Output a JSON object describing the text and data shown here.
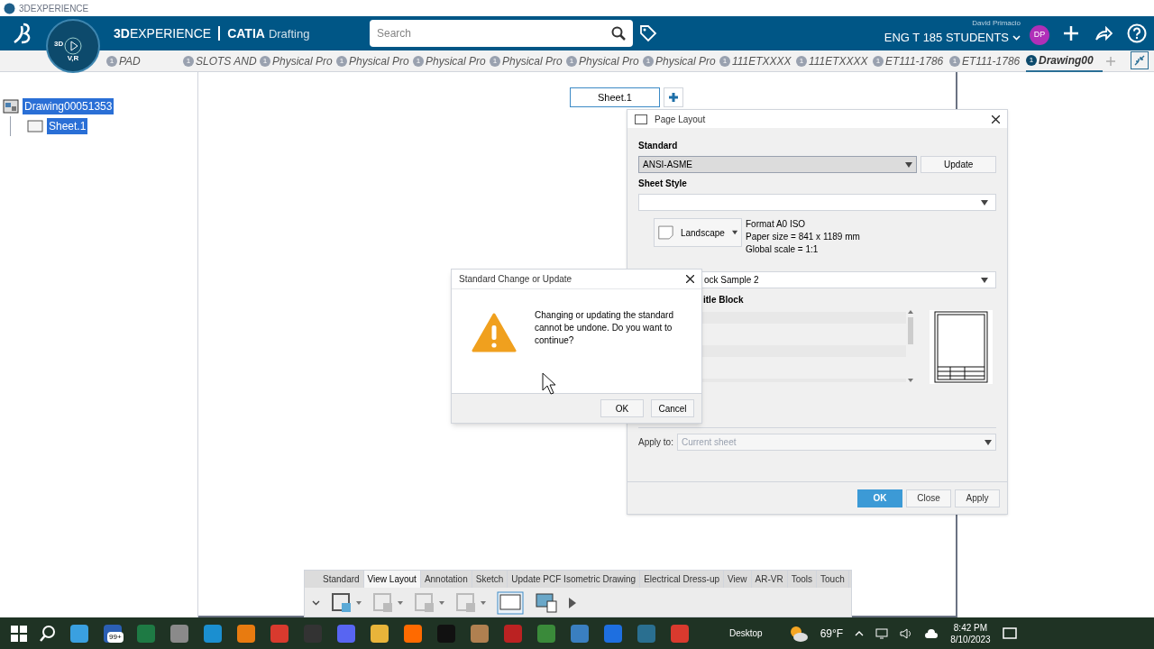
{
  "window": {
    "title": "3DEXPERIENCE"
  },
  "header": {
    "brand": "3DEXPERIENCE",
    "app": "CATIA",
    "module": "Drafting",
    "compass_labels": [
      "3D",
      "V,R"
    ],
    "search": {
      "placeholder": "Search"
    },
    "user": "David Primacio",
    "collab_space": "ENG T 185 STUDENTS",
    "avatar": "DP"
  },
  "tabs": [
    {
      "label": "PAD",
      "badge": "1",
      "selected": false
    },
    {
      "label": "SLOTS AND",
      "badge": "1",
      "selected": false
    },
    {
      "label": "Physical Pro",
      "badge": "1",
      "selected": false
    },
    {
      "label": "Physical Pro",
      "badge": "1",
      "selected": false
    },
    {
      "label": "Physical Pro",
      "badge": "1",
      "selected": false
    },
    {
      "label": "Physical Pro",
      "badge": "1",
      "selected": false
    },
    {
      "label": "Physical Pro",
      "badge": "1",
      "selected": false
    },
    {
      "label": "Physical Pro",
      "badge": "1",
      "selected": false
    },
    {
      "label": "111ETXXXX",
      "badge": "1",
      "selected": false
    },
    {
      "label": "111ETXXXX",
      "badge": "1",
      "selected": false
    },
    {
      "label": "ET111-1786",
      "badge": "1",
      "selected": false
    },
    {
      "label": "ET111-1786",
      "badge": "1",
      "selected": false
    },
    {
      "label": "Drawing00",
      "badge": "1",
      "selected": true
    }
  ],
  "tree": {
    "label": "Drawing00051353",
    "selected": true,
    "children": [
      {
        "label": "Sheet.1",
        "selected": true
      }
    ]
  },
  "sheet_tab": {
    "label": "Sheet.1"
  },
  "page_layout": {
    "title": "Page Layout",
    "standard_label": "Standard",
    "standard_value": "ANSI-ASME",
    "update_button": "Update",
    "sheet_style_label": "Sheet Style",
    "orientation": "Landscape",
    "format_lines": [
      "Format A0 ISO",
      "Paper size = 841 x 1189 mm",
      "Global scale = 1:1"
    ],
    "dressup_value": "ock Sample 2",
    "title_block_label": "itle Block",
    "apply_to_label": "Apply to:",
    "apply_to_value": "Current sheet",
    "buttons": [
      "OK",
      "Close",
      "Apply"
    ]
  },
  "confirm_dialog": {
    "title": "Standard Change or Update",
    "message": "Changing or updating the standard cannot be undone. Do you want to continue?",
    "buttons": [
      "OK",
      "Cancel"
    ]
  },
  "toolbar": {
    "tabs": [
      {
        "label": "Standard",
        "selected": false
      },
      {
        "label": "View Layout",
        "selected": true
      },
      {
        "label": "Annotation",
        "selected": false
      },
      {
        "label": "Sketch",
        "selected": false
      },
      {
        "label": "Update PCF Isometric Drawing",
        "selected": false
      },
      {
        "label": "Electrical Dress-up",
        "selected": false
      },
      {
        "label": "View",
        "selected": false
      },
      {
        "label": "AR-VR",
        "selected": false
      },
      {
        "label": "Tools",
        "selected": false
      },
      {
        "label": "Touch",
        "selected": false
      }
    ]
  },
  "taskbar": {
    "mail_badge": "99+",
    "desktop_label": "Desktop",
    "weather": "69°F",
    "time": "8:42 PM",
    "date": "8/10/2023"
  }
}
